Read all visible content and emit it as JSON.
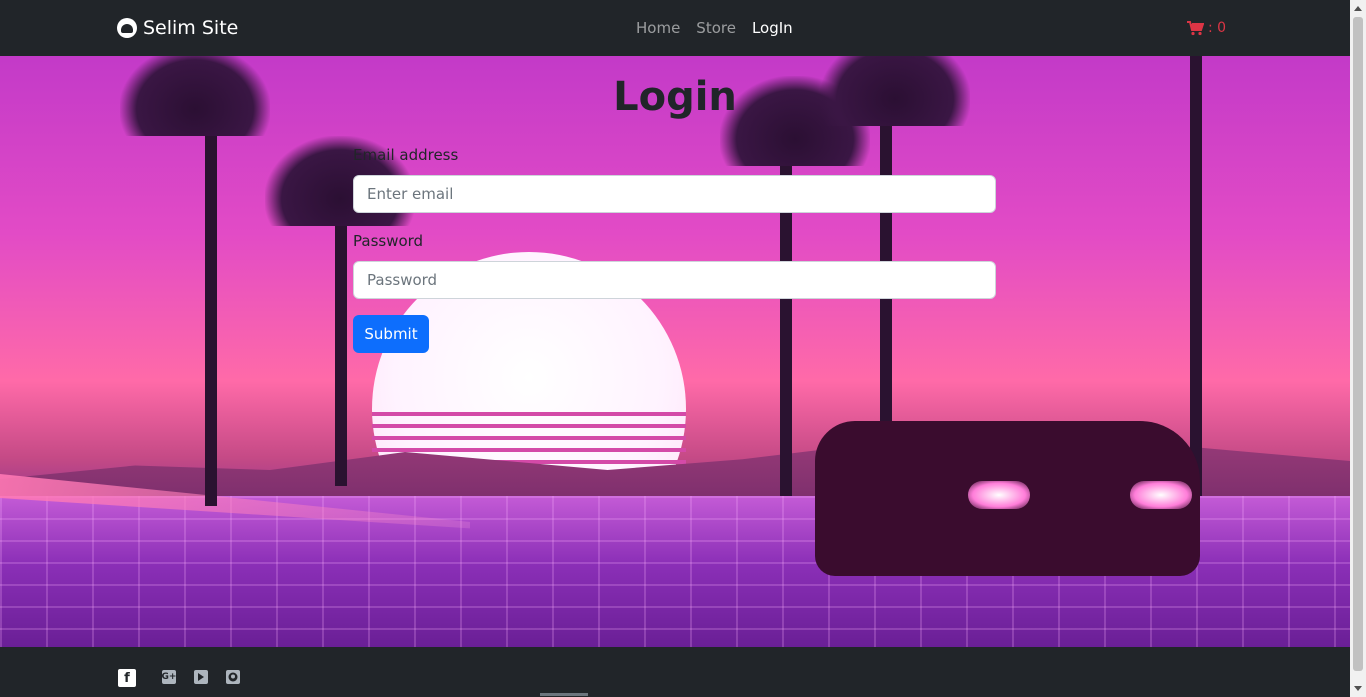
{
  "navbar": {
    "brand": "Selim Site",
    "links": [
      {
        "label": "Home",
        "active": false
      },
      {
        "label": "Store",
        "active": false
      },
      {
        "label": "LogIn",
        "active": true
      }
    ],
    "cart_text": ": 0",
    "cart_icon": "shopping-cart-icon",
    "cart_color": "#dc3545"
  },
  "login": {
    "title": "Login",
    "email_label": "Email address",
    "email_placeholder": "Enter email",
    "password_label": "Password",
    "password_placeholder": "Password",
    "submit_label": "Submit",
    "submit_color": "#0d6efd"
  },
  "footer": {
    "icons": [
      "facebook-icon",
      "google-plus-icon",
      "youtube-icon",
      "github-icon"
    ]
  }
}
